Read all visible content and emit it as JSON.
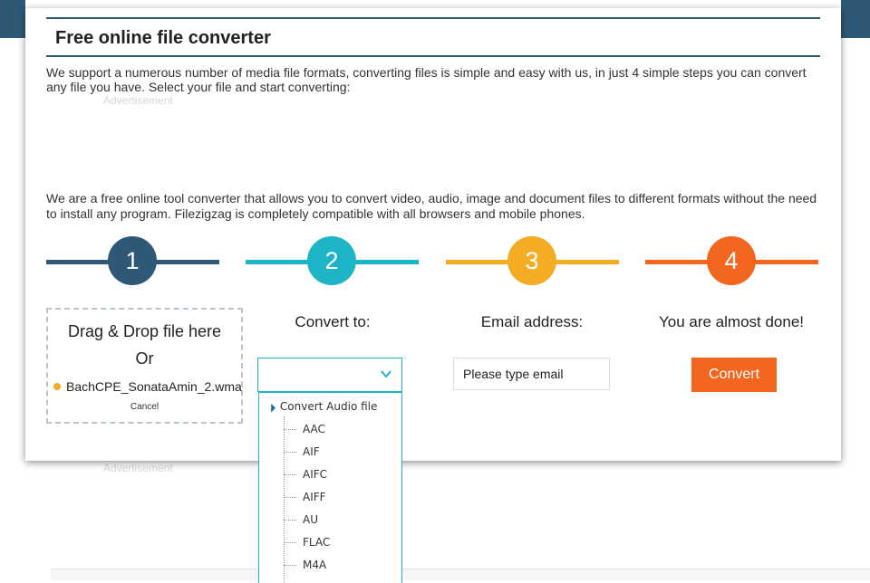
{
  "header": {
    "title": "Free online file converter"
  },
  "intro": "We support a numerous number of media file formats, converting files is simple and easy with us, in just 4 simple steps you can convert any file you have. Select your file and start converting:",
  "ads": {
    "label": "Advertisement"
  },
  "description": "We are a free online tool converter that allows you to convert video, audio, image and document files to different formats without the need to install any program. Filezigzag is completely compatible with all browsers and mobile phones.",
  "steps": [
    {
      "number": "1",
      "color": "#2f5876"
    },
    {
      "number": "2",
      "color": "#1db4c8"
    },
    {
      "number": "3",
      "color": "#f4ac24"
    },
    {
      "number": "4",
      "color": "#f2661f"
    }
  ],
  "upload": {
    "drag_text": "Drag & Drop file here",
    "or_text": "Or",
    "file_name": "BachCPE_SonataAmin_2.wma",
    "cancel_label": "Cancel"
  },
  "convert_to": {
    "label": "Convert to:",
    "selected": "",
    "group_label": "Convert Audio file",
    "options": [
      "AAC",
      "AIF",
      "AIFC",
      "AIFF",
      "AU",
      "FLAC",
      "M4A"
    ]
  },
  "email": {
    "label": "Email address:",
    "placeholder": "Please type email"
  },
  "finish": {
    "label": "You are almost done!",
    "button_label": "Convert"
  }
}
